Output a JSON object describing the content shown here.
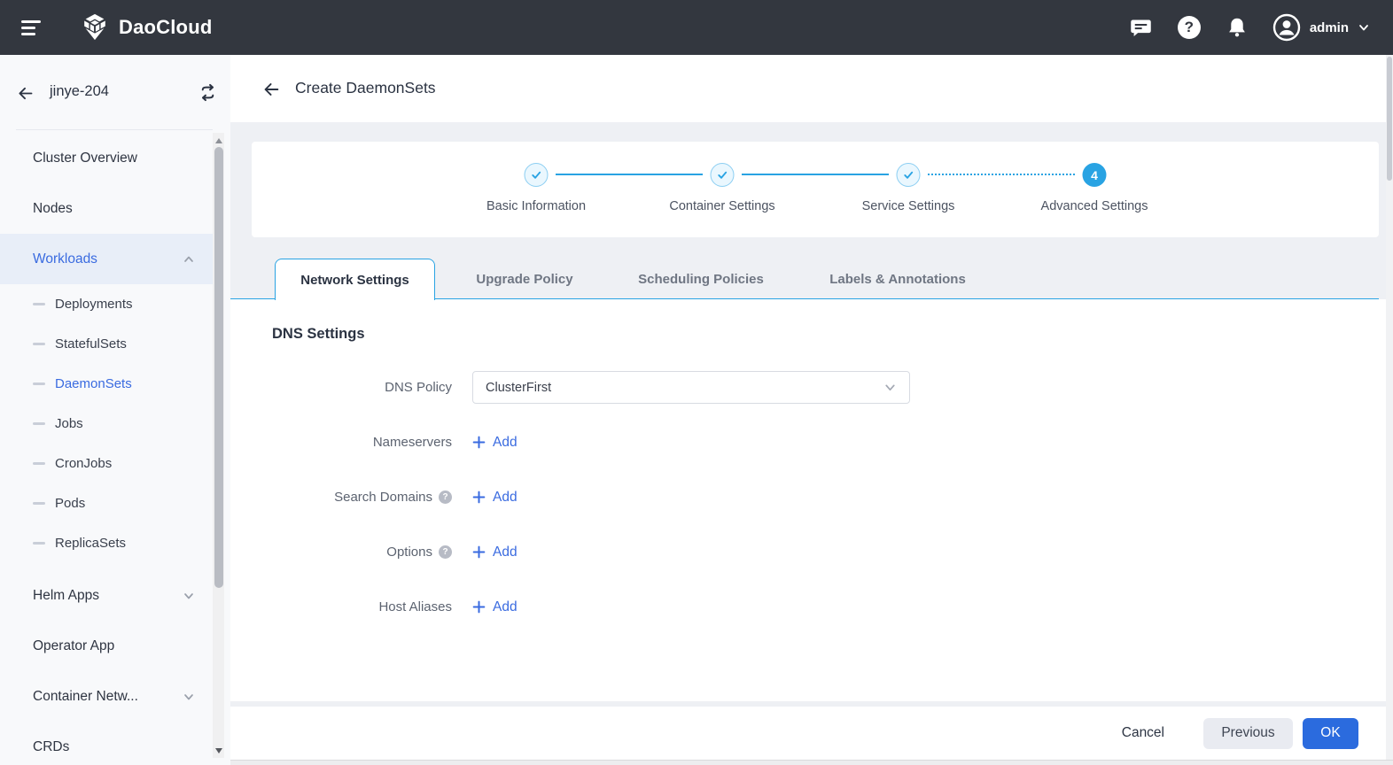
{
  "glyphs": {
    "question": "?"
  },
  "colors": {
    "header_bg": "#33373f",
    "accent_blue": "#3a6be0",
    "sky_blue": "#29a3e3",
    "ok_button_blue": "#2b6bde",
    "page_bg": "#eef0f4",
    "sidebar_bg": "#f8f9fb",
    "sidebar_active_bg": "#e8eef8"
  },
  "header": {
    "brand": "DaoCloud",
    "user_label": "admin"
  },
  "sidebar": {
    "cluster_name": "jinye-204",
    "items": [
      {
        "label": "Cluster Overview"
      },
      {
        "label": "Nodes"
      },
      {
        "label": "Workloads",
        "active": true,
        "expanded": true
      },
      {
        "label": "Deployments",
        "sub": true
      },
      {
        "label": "StatefulSets",
        "sub": true
      },
      {
        "label": "DaemonSets",
        "sub": true,
        "active": true
      },
      {
        "label": "Jobs",
        "sub": true
      },
      {
        "label": "CronJobs",
        "sub": true
      },
      {
        "label": "Pods",
        "sub": true
      },
      {
        "label": "ReplicaSets",
        "sub": true
      },
      {
        "label": "Helm Apps",
        "collapsible": true
      },
      {
        "label": "Operator App"
      },
      {
        "label": "Container Netw...",
        "collapsible": true
      },
      {
        "label": "CRDs"
      }
    ]
  },
  "page": {
    "title": "Create DaemonSets",
    "stepper": {
      "steps": [
        {
          "label": "Basic Information",
          "state": "done"
        },
        {
          "label": "Container Settings",
          "state": "done"
        },
        {
          "label": "Service Settings",
          "state": "done"
        },
        {
          "label": "Advanced Settings",
          "state": "active",
          "number": "4"
        }
      ]
    },
    "tabs": [
      {
        "label": "Network Settings",
        "active": true
      },
      {
        "label": "Upgrade Policy"
      },
      {
        "label": "Scheduling Policies"
      },
      {
        "label": "Labels & Annotations"
      }
    ],
    "section_title": "DNS Settings",
    "form": {
      "dns_policy_label": "DNS Policy",
      "dns_policy_value": "ClusterFirst",
      "rows": [
        {
          "label": "Nameservers",
          "add_label": "Add",
          "help": false
        },
        {
          "label": "Search Domains",
          "add_label": "Add",
          "help": true
        },
        {
          "label": "Options",
          "add_label": "Add",
          "help": true
        },
        {
          "label": "Host Aliases",
          "add_label": "Add",
          "help": false
        }
      ]
    },
    "footer": {
      "cancel": "Cancel",
      "previous": "Previous",
      "ok": "OK"
    }
  }
}
